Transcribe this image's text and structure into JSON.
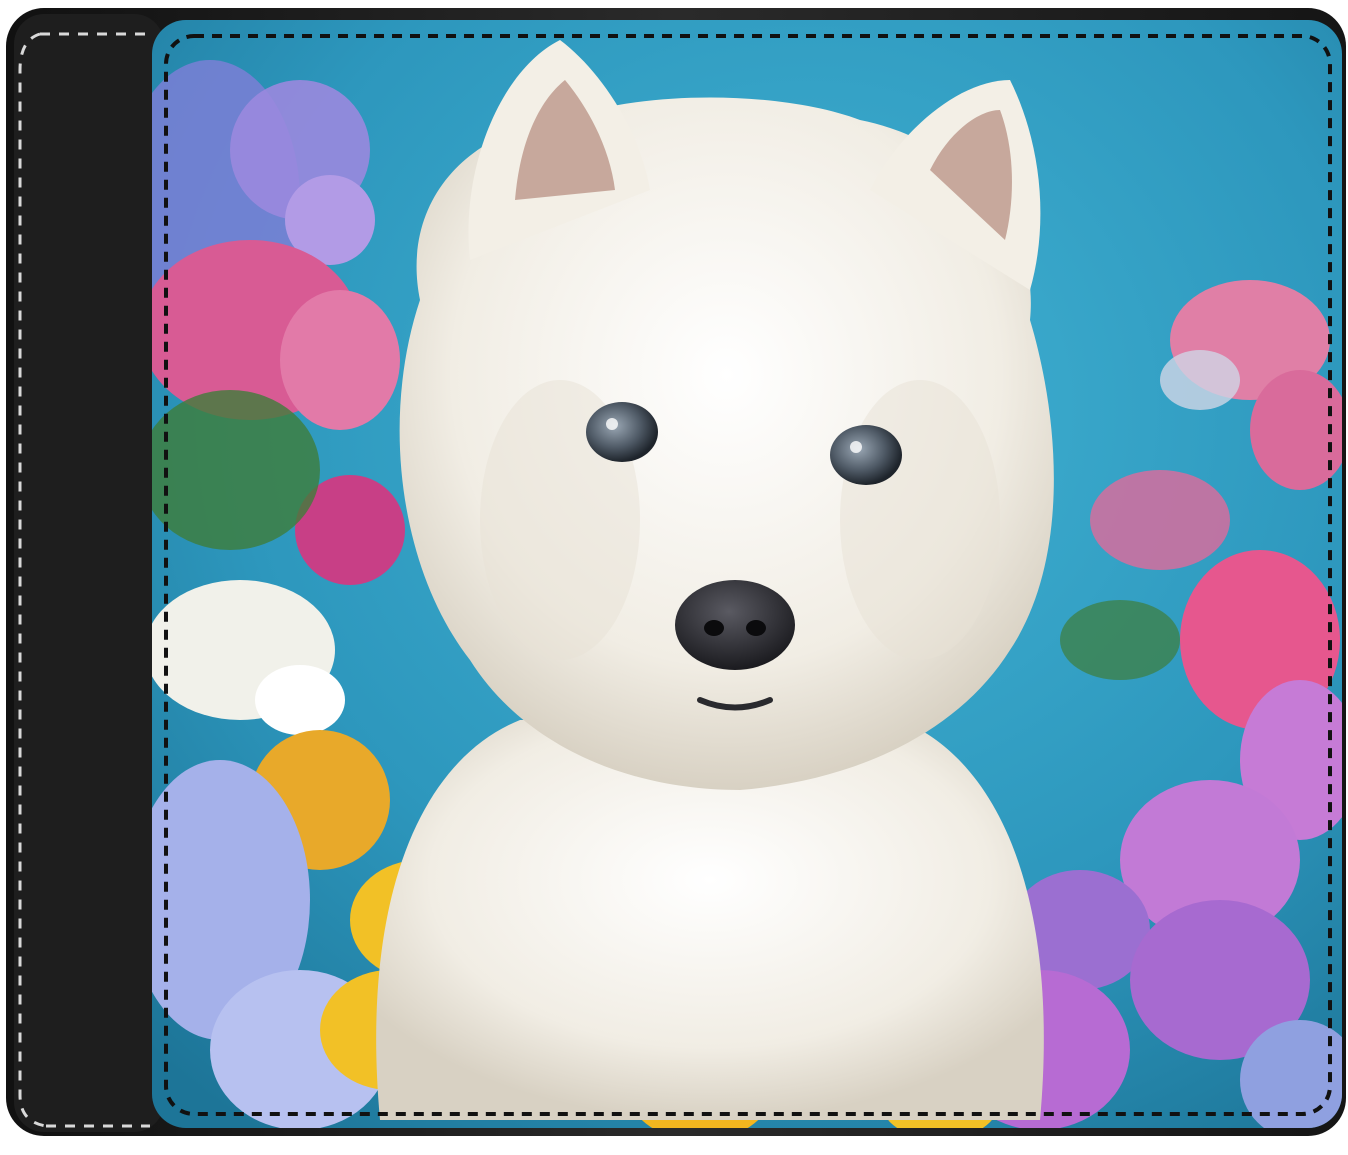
{
  "scene": {
    "subject": "west-highland-terrier",
    "object": "bifold-wallet",
    "colors": {
      "page_bg": "#ffffff",
      "leather": "#1c1c1c",
      "leather_highlight": "#3a3a3a",
      "stitch_light": "#d8d8d8",
      "stitch_dark": "#111111",
      "sky_blue": "#2f9fc2",
      "sky_blue_deep": "#1f7fa6",
      "fur_white": "#f4f1ea",
      "fur_shadow": "#d9d3c6",
      "eye": "#4b5563",
      "nose": "#2a2a2e",
      "flower_purple": "#9b6fd1",
      "flower_lavender": "#a9b4e8",
      "flower_pink": "#e0699a",
      "flower_magenta": "#c9489a",
      "flower_yellow": "#f2c126",
      "flower_white": "#f3f3ee",
      "leaf_green": "#3f7d3a"
    }
  }
}
